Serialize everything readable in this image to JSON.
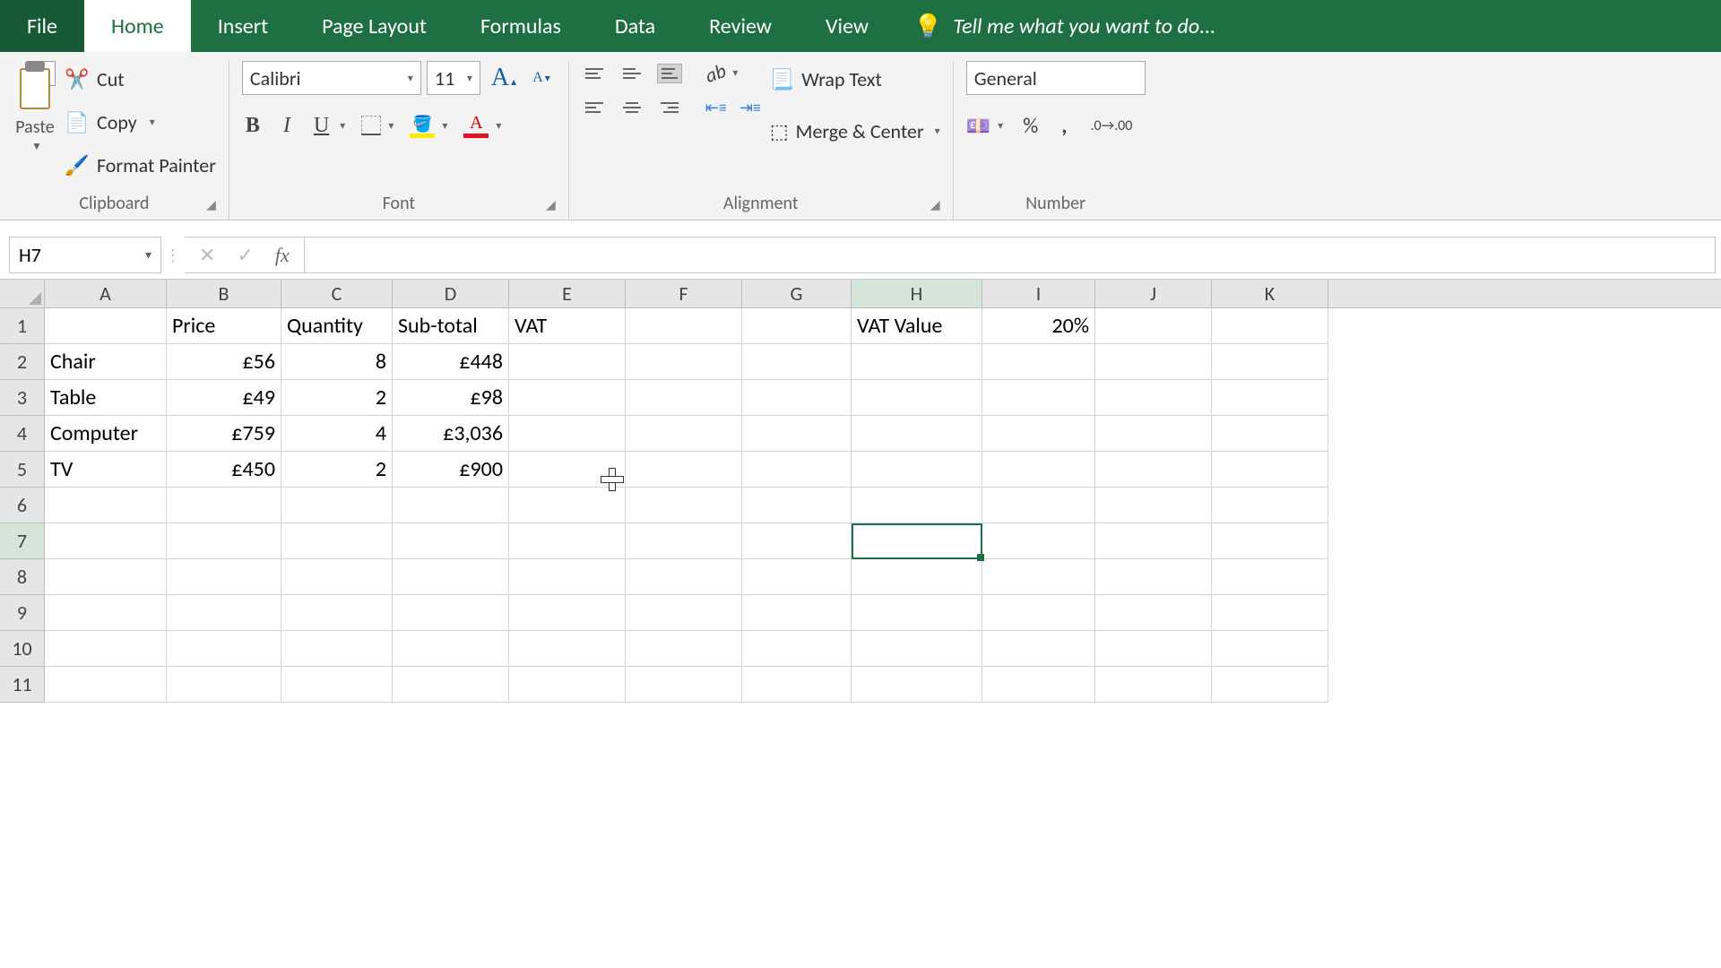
{
  "tabs": {
    "file": "File",
    "home": "Home",
    "insert": "Insert",
    "page_layout": "Page Layout",
    "formulas": "Formulas",
    "data": "Data",
    "review": "Review",
    "view": "View",
    "tell_me": "Tell me what you want to do..."
  },
  "ribbon": {
    "clipboard": {
      "paste": "Paste",
      "cut": "Cut",
      "copy": "Copy",
      "format_painter": "Format Painter",
      "label": "Clipboard"
    },
    "font": {
      "name": "Calibri",
      "size": "11",
      "bold": "B",
      "italic": "I",
      "underline": "U",
      "font_color_letter": "A",
      "label": "Font"
    },
    "alignment": {
      "wrap_text": "Wrap Text",
      "merge_center": "Merge & Center",
      "label": "Alignment"
    },
    "number": {
      "format": "General",
      "percent": "%",
      "comma": ",",
      "label": "Number"
    }
  },
  "formula_bar": {
    "name_box": "H7",
    "formula": ""
  },
  "columns": [
    "A",
    "B",
    "C",
    "D",
    "E",
    "F",
    "G",
    "H",
    "I",
    "J",
    "K"
  ],
  "rows": [
    "1",
    "2",
    "3",
    "4",
    "5",
    "6",
    "7",
    "8",
    "9",
    "10",
    "11"
  ],
  "grid": {
    "r1": {
      "B": "Price",
      "C": "Quantity",
      "D": "Sub-total",
      "E": "VAT",
      "H": "VAT Value",
      "I": "20%"
    },
    "r2": {
      "A": "Chair",
      "B": "£56",
      "C": "8",
      "D": "£448"
    },
    "r3": {
      "A": "Table",
      "B": "£49",
      "C": "2",
      "D": "£98"
    },
    "r4": {
      "A": "Computer",
      "B": "£759",
      "C": "4",
      "D": "£3,036"
    },
    "r5": {
      "A": "TV",
      "B": "£450",
      "C": "2",
      "D": "£900"
    }
  },
  "selected_cell": "H7"
}
